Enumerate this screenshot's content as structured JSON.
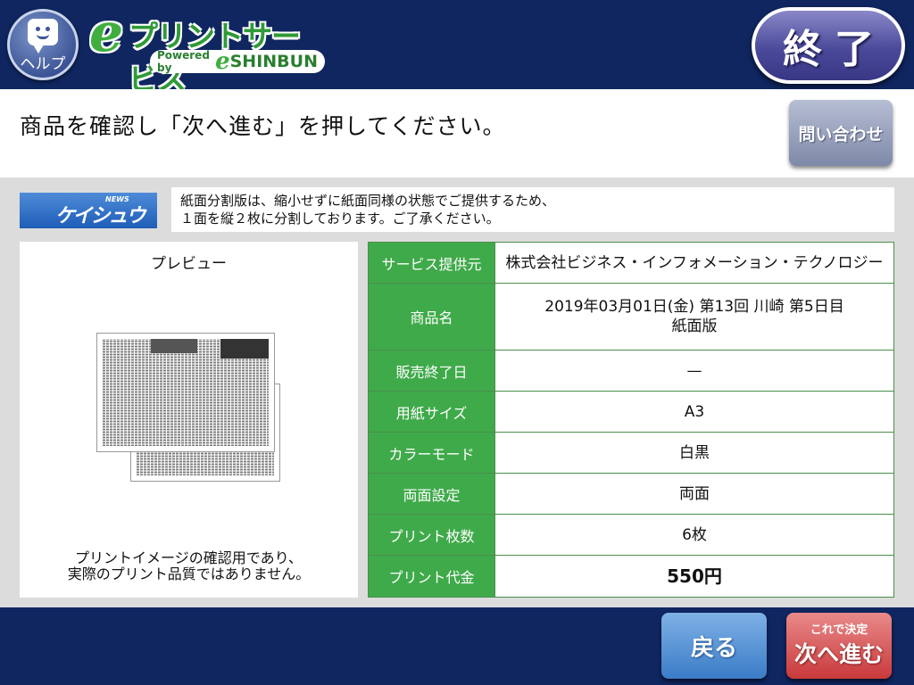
{
  "header": {
    "help_label": "ヘルプ",
    "logo_main": "プリントサービス",
    "logo_e": "e",
    "logo_powered": "Powered by",
    "logo_e2": "e",
    "logo_shinbun": "SHINBUN",
    "end_label": "終了"
  },
  "instruction": {
    "text": "商品を確認し「次へ進む」を押してください。",
    "inquiry_label": "問い合わせ"
  },
  "publisher": {
    "news_label": "NEWS",
    "name": "ケイシュウ"
  },
  "notice": {
    "line1": "紙面分割版は、縮小せずに紙面同様の状態でご提供するため、",
    "line2": "１面を縦２枚に分割しております。ご了承ください。"
  },
  "preview": {
    "title": "プレビュー",
    "note_line1": "プリントイメージの確認用であり、",
    "note_line2": "実際のプリント品質ではありません。"
  },
  "details": {
    "rows": [
      {
        "label": "サービス提供元",
        "value": "株式会社ビジネス・インフォメーション・テクノロジー"
      },
      {
        "label": "商品名",
        "value": "2019年03月01日(金) 第13回 川崎 第5日目",
        "value2": "紙面版"
      },
      {
        "label": "販売終了日",
        "value": "—"
      },
      {
        "label": "用紙サイズ",
        "value": "A3"
      },
      {
        "label": "カラーモード",
        "value": "白黒"
      },
      {
        "label": "両面設定",
        "value": "両面"
      },
      {
        "label": "プリント枚数",
        "value": "6枚"
      },
      {
        "label": "プリント代金",
        "value": "550円"
      }
    ]
  },
  "footer": {
    "back_label": "戻る",
    "next_sub_label": "これで決定",
    "next_label": "次へ進む"
  },
  "colors": {
    "header_bg": "#0f2660",
    "label_green": "#3faa4a",
    "end_button": "#4b4a9a",
    "back_button": "#3a7cc7",
    "next_button": "#c9393b"
  }
}
